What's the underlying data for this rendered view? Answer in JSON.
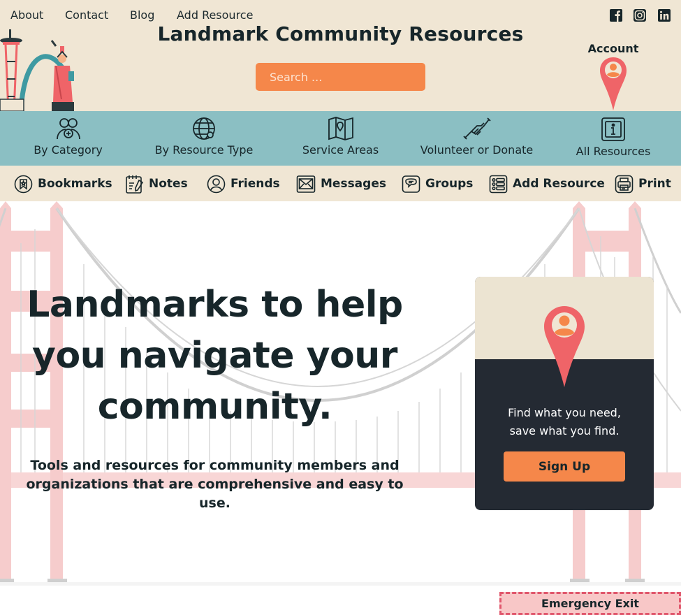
{
  "header": {
    "top_links": [
      "About",
      "Contact",
      "Blog",
      "Add Resource"
    ],
    "site_title": "Landmark Community Resources",
    "search_placeholder": "Search ...",
    "account_label": "Account",
    "social_icons": [
      "facebook-icon",
      "instagram-icon",
      "linkedin-icon"
    ]
  },
  "category_nav": [
    {
      "label": "By Category",
      "icon": "people-category-icon"
    },
    {
      "label": "By Resource Type",
      "icon": "globe-icon"
    },
    {
      "label": "Service Areas",
      "icon": "map-icon"
    },
    {
      "label": "Volunteer or Donate",
      "icon": "handshake-icon"
    },
    {
      "label": "All Resources",
      "icon": "info-tablet-icon"
    }
  ],
  "tool_nav": [
    {
      "label": "Bookmarks",
      "icon": "bookmark-icon"
    },
    {
      "label": "Notes",
      "icon": "notes-icon"
    },
    {
      "label": "Friends",
      "icon": "friends-icon"
    },
    {
      "label": "Messages",
      "icon": "envelope-icon"
    },
    {
      "label": "Groups",
      "icon": "chat-bubble-icon"
    },
    {
      "label": "Add Resource",
      "icon": "list-add-icon"
    },
    {
      "label": "Print",
      "icon": "printer-icon"
    }
  ],
  "hero": {
    "headline": "Landmarks to help you navigate your community.",
    "subhead": "Tools and resources for community members and organizations that are comprehensive and easy to use."
  },
  "card": {
    "text_line1": "Find what you need,",
    "text_line2": "save what you find.",
    "button_label": "Sign Up"
  },
  "emergency_exit_label": "Emergency Exit",
  "colors": {
    "cream": "#f0e6d4",
    "teal": "#8bbfc3",
    "orange": "#f5874a",
    "coral_pin": "#ef6468",
    "dark": "#17262a",
    "card_dark": "#242a33",
    "bridge_pink": "#f6cccc",
    "bridge_cable": "#cfcfcf"
  }
}
